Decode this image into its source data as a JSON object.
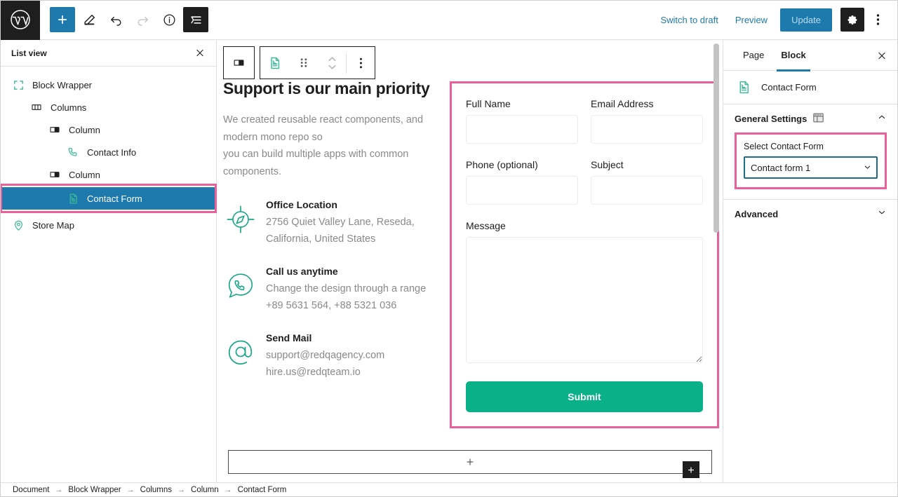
{
  "topbar": {
    "logo_icon": "wordpress-logo-icon",
    "add_block_icon": "plus-icon",
    "edit_icon": "pencil-icon",
    "undo_icon": "undo-arrow-icon",
    "redo_icon": "redo-arrow-icon",
    "details_icon": "info-circle-icon",
    "listview_icon": "list-view-icon",
    "switch_to_draft": "Switch to draft",
    "preview": "Preview",
    "update": "Update",
    "settings_icon": "gear-icon",
    "options_icon": "kebab-menu-icon"
  },
  "listview": {
    "title": "List view",
    "close_icon": "close-icon",
    "items": [
      {
        "label": "Block Wrapper",
        "icon": "block-wrapper-icon",
        "depth": 0,
        "selected": false
      },
      {
        "label": "Columns",
        "icon": "columns-icon",
        "depth": 1,
        "selected": false
      },
      {
        "label": "Column",
        "icon": "column-icon",
        "depth": 2,
        "selected": false
      },
      {
        "label": "Contact Info",
        "icon": "phone-icon",
        "depth": 3,
        "selected": false
      },
      {
        "label": "Column",
        "icon": "column-icon",
        "depth": 2,
        "selected": false
      },
      {
        "label": "Contact Form",
        "icon": "contact-form-icon",
        "depth": 3,
        "selected": true
      },
      {
        "label": "Store Map",
        "icon": "map-pin-icon",
        "depth": 0,
        "selected": false
      }
    ]
  },
  "block_toolbar": {
    "parent_block_icon": "column-icon",
    "block_type_icon": "contact-form-icon",
    "drag_icon": "drag-handle-icon",
    "move_icon": "move-up-down-icon",
    "more_icon": "kebab-menu-icon"
  },
  "canvas": {
    "heading": "Support is our main priority",
    "paragraph_lines": [
      "We created reusable react components, and",
      "modern mono repo so",
      "you can build multiple apps with common",
      "components."
    ],
    "info_items": [
      {
        "icon": "compass-icon",
        "title": "Office Location",
        "lines": [
          "2756 Quiet Valley Lane, Reseda,",
          "California, United States"
        ]
      },
      {
        "icon": "phone-chat-icon",
        "title": "Call us anytime",
        "lines": [
          "Change the design through a range",
          "+89 5631 564,  +88 5321 036"
        ]
      },
      {
        "icon": "at-sign-icon",
        "title": "Send Mail",
        "lines": [
          "support@redqagency.com",
          "hire.us@redqteam.io"
        ]
      }
    ],
    "form": {
      "full_name_label": "Full Name",
      "full_name_value": "",
      "email_label": "Email Address",
      "email_value": "",
      "phone_label": "Phone (optional)",
      "phone_value": "",
      "subject_label": "Subject",
      "subject_value": "",
      "message_label": "Message",
      "message_value": "",
      "submit_label": "Submit",
      "submit_color": "#0ab087",
      "selection_outline_color": "#ec5f9a"
    },
    "add_badge_icon": "plus-icon",
    "appender_icon": "plus-icon"
  },
  "sidebar": {
    "tabs": [
      {
        "label": "Page",
        "active": false
      },
      {
        "label": "Block",
        "active": true
      }
    ],
    "close_icon": "close-icon",
    "block_name": "Contact Form",
    "block_icon": "contact-form-icon",
    "panels": [
      {
        "title": "General Settings",
        "icon": "layout-grid-icon",
        "expanded": true
      },
      {
        "title": "Advanced",
        "icon": "",
        "expanded": false
      }
    ],
    "select_contact_form_label": "Select Contact Form",
    "select_contact_form_value": "Contact form 1",
    "select_contact_form_options": [
      "Contact form 1"
    ],
    "chevron_up_icon": "chevron-up-icon",
    "chevron_down_icon": "chevron-down-icon",
    "highlight_color": "#ec5f9a"
  },
  "breadcrumb": {
    "separator": "→",
    "items": [
      "Document",
      "Block Wrapper",
      "Columns",
      "Column",
      "Contact Form"
    ]
  },
  "colors": {
    "wp_blue": "#1e7aad",
    "teal": "#0ab087",
    "pink_highlight": "#ec5f9a",
    "dark": "#1e1e1e"
  }
}
